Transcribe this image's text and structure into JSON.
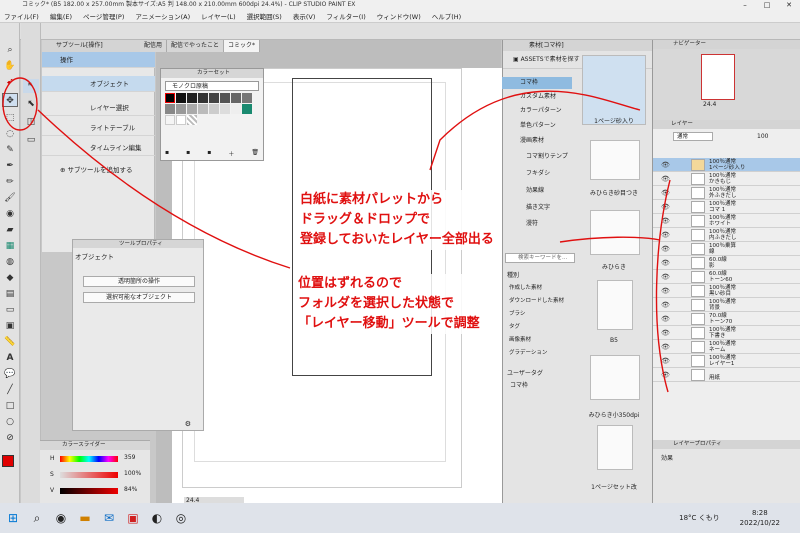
{
  "window": {
    "title": "コミック* (B5 182.00 x 257.00mm 製本サイズ:A5 判 148.00 x 210.00mm 600dpi 24.4%) - CLIP STUDIO PAINT EX"
  },
  "menu": [
    "ファイル(F)",
    "編集(E)",
    "ページ管理(P)",
    "アニメーション(A)",
    "レイヤー(L)",
    "選択範囲(S)",
    "表示(V)",
    "フィルター(I)",
    "ウィンドウ(W)",
    "ヘルプ(H)"
  ],
  "tabs": [
    "配信用",
    "配信でやったこと",
    "コミック*"
  ],
  "subtool": {
    "header": "サブツール[操作]",
    "group": "操作",
    "items": [
      "オブジェクト",
      "レイヤー選択",
      "ライトテーブル",
      "タイムライン編集"
    ],
    "add": "サブツールを追加する"
  },
  "colorset": {
    "header": "カラーセット",
    "preset": "モノクロ原稿"
  },
  "toolprop": {
    "header": "ツールプロパティ",
    "title": "オブジェクト",
    "dd1": "透明箇所の操作",
    "dd2": "選択可能なオブジェクト"
  },
  "colorslider": {
    "header": "カラースライダー",
    "h": "359",
    "s": "100%",
    "v": "84%"
  },
  "canvas": {
    "zoom": "24.4"
  },
  "material": {
    "tab": "素材[コマ枠]",
    "assets_label": "ASSETSで素材を探す",
    "tree": [
      "コマ枠",
      "カスタム素材",
      "カラーパターン",
      "単色パターン",
      "漫画素材",
      "コマ割りテンプ",
      "フキダシ",
      "効果線",
      "描き文字",
      "漫符"
    ],
    "search_placeholder": "検索キーワードを...",
    "tags_header": "種別",
    "tags": [
      "作成した素材",
      "ダウンロードした素材",
      "ブラシ",
      "タグ",
      "画像素材",
      "グラデーション"
    ],
    "user_tag_header": "ユーザータグ",
    "user_tags": [
      "コマ枠"
    ],
    "thumbs": [
      "1ページ砂入り",
      "みひらき砂目つき",
      "みひらき",
      "B5",
      "みひらき小350dpi",
      "1ページセット改"
    ]
  },
  "navigator": {
    "header": "ナビゲーター",
    "zoom": "24.4"
  },
  "layers": {
    "header": "レイヤー",
    "blend": "通常",
    "opacity": "100",
    "items": [
      {
        "line1": "100％通常",
        "line2": "1ページ砂入り"
      },
      {
        "line1": "100％通常",
        "line2": "かきもじ"
      },
      {
        "line1": "100％通常",
        "line2": "外ふきだし"
      },
      {
        "line1": "100％通常",
        "line2": "コマ 1"
      },
      {
        "line1": "100％通常",
        "line2": "ホワイト"
      },
      {
        "line1": "100％通常",
        "line2": "内ふきだし"
      },
      {
        "line1": "100％乗算",
        "line2": "線"
      },
      {
        "line1": "60.0線",
        "line2": "影"
      },
      {
        "line1": "60.0線",
        "line2": "トーン60"
      },
      {
        "line1": "100％通常",
        "line2": "黒い砂目"
      },
      {
        "line1": "100％通常",
        "line2": "背景"
      },
      {
        "line1": "70.0線",
        "line2": "トーン70"
      },
      {
        "line1": "100％通常",
        "line2": "下書き"
      },
      {
        "line1": "100％通常",
        "line2": "ネーム"
      },
      {
        "line1": "100％通常",
        "line2": "レイヤー1"
      },
      {
        "line1": "",
        "line2": "用紙"
      }
    ]
  },
  "layer_property": {
    "header": "レイヤープロパティ",
    "effect": "効果"
  },
  "annotations": {
    "main": [
      "白紙に素材パレットから",
      "ドラッグ＆ドロップで",
      "登録しておいたレイヤー全部出る"
    ],
    "sub": [
      "位置はずれるので",
      "フォルダを選択した状態で",
      "「レイヤー移動」ツールで調整"
    ]
  },
  "taskbar": {
    "weather": "18°C くもり",
    "time": "8:28",
    "date": "2022/10/22"
  },
  "colors": {
    "annotation": "#e01010",
    "selected": "#8fbbe0",
    "accent_teal": "#1a8a70"
  }
}
